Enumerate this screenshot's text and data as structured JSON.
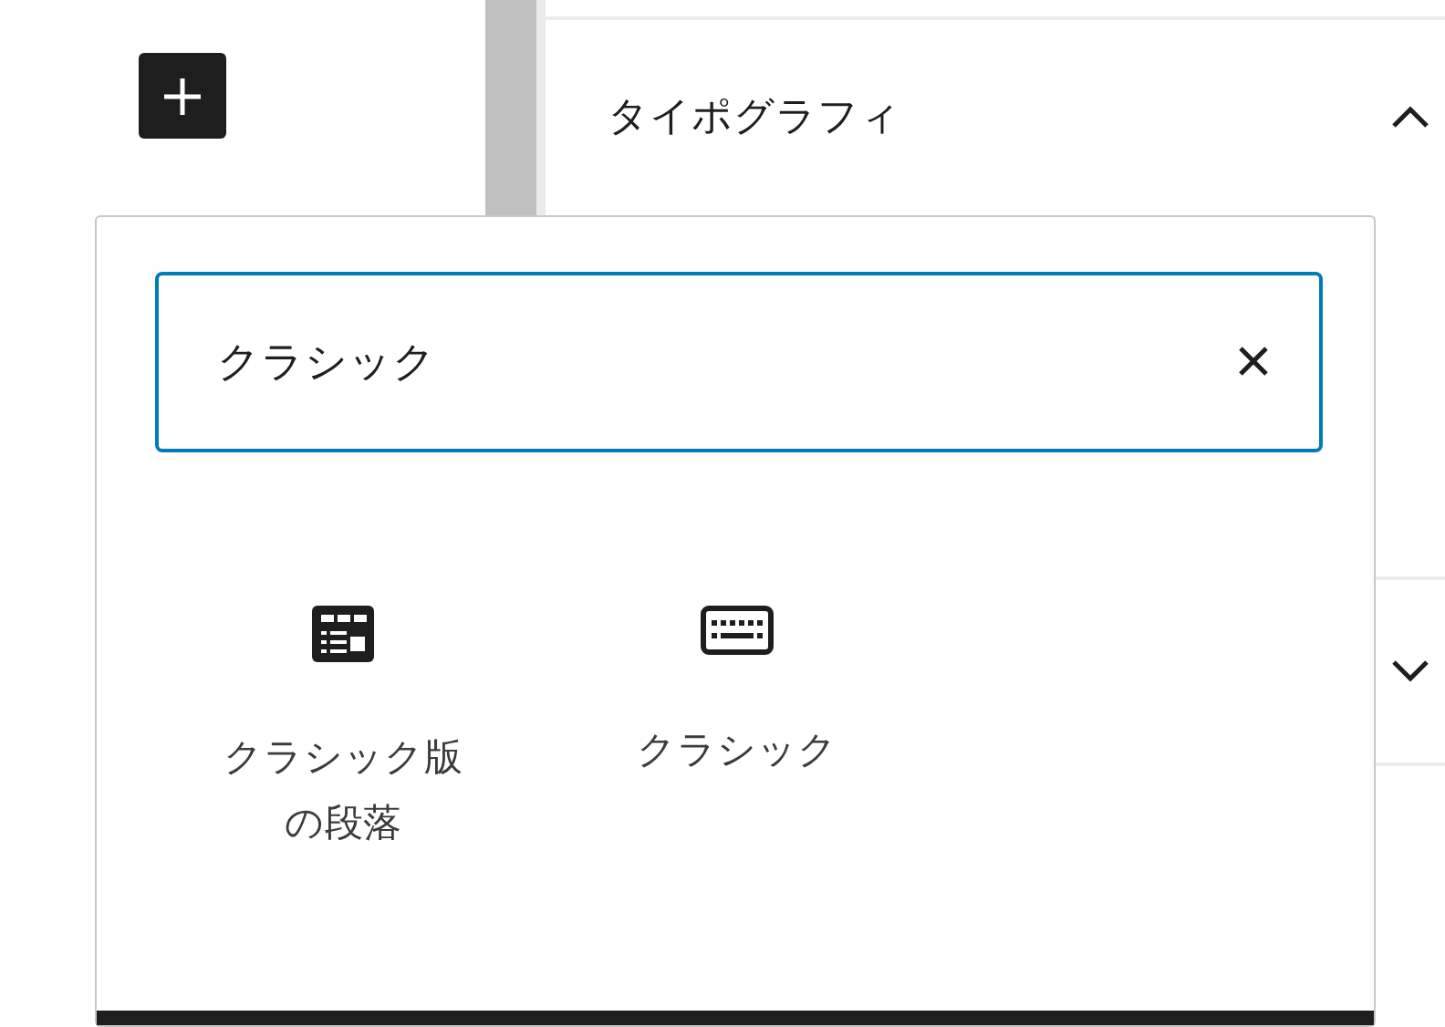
{
  "sidebar": {
    "panels": [
      {
        "title": "タイポグラフィ",
        "expanded": true
      },
      {
        "expanded": false
      }
    ]
  },
  "inserter": {
    "search": {
      "value": "クラシック"
    },
    "results": [
      {
        "label": "クラシック版の段落",
        "kind": "table"
      },
      {
        "label": "クラシック",
        "kind": "keyboard"
      }
    ]
  }
}
